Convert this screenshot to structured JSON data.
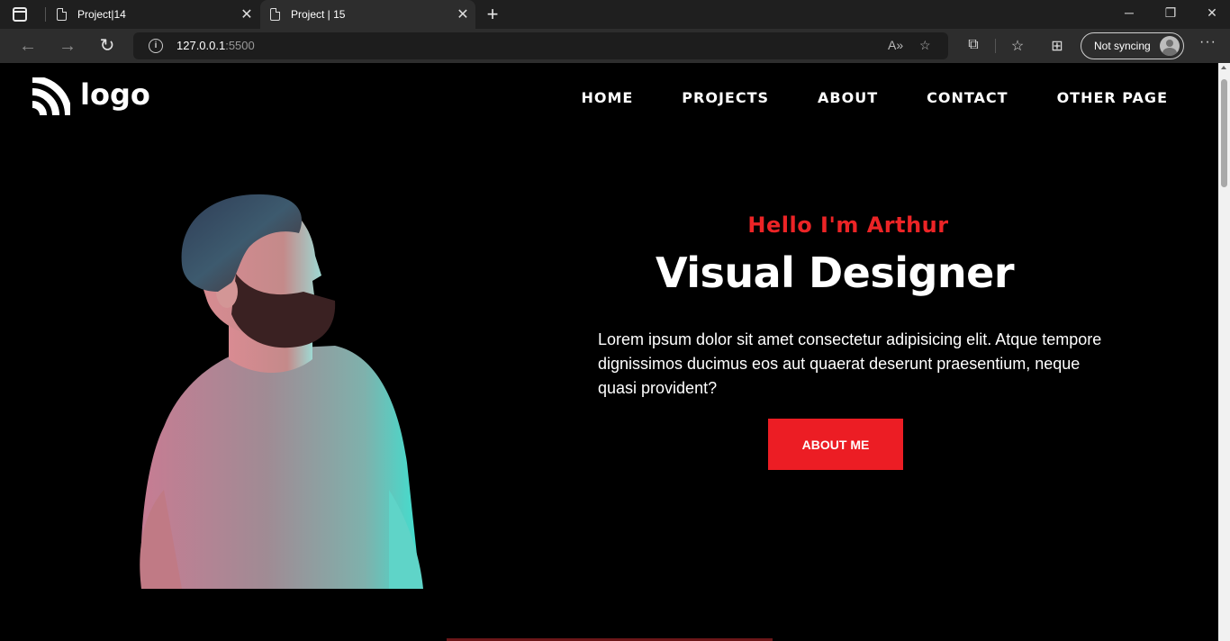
{
  "browser": {
    "tabs": [
      {
        "title": "Project|14",
        "active": false
      },
      {
        "title": "Project | 15",
        "active": true
      }
    ],
    "url_host": "127.0.0.1",
    "url_port": ":5500",
    "profile_label": "Not syncing"
  },
  "site": {
    "logo_text": "logo",
    "nav": [
      "HOME",
      "PROJECTS",
      "ABOUT",
      "CONTACT",
      "OTHER PAGE"
    ]
  },
  "hero": {
    "greeting": "Hello I'm Arthur",
    "role": "Visual Designer",
    "description": "Lorem ipsum dolor sit amet consectetur adipisicing elit. Atque tempore dignissimos ducimus eos aut quaerat deserunt praesentium, neque quasi provident?",
    "button_label": "ABOUT ME"
  },
  "colors": {
    "accent": "#ec2426",
    "background": "#000000",
    "text": "#ffffff"
  }
}
